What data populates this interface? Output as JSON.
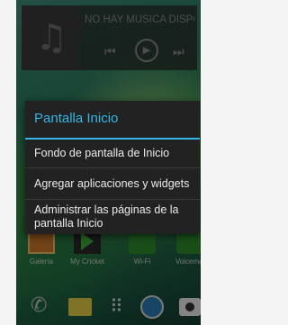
{
  "music_widget": {
    "title": "NO HAY MÚSICA DISPONIBLE",
    "album_icon": "music-note-icon",
    "prev_icon": "⏮",
    "play_icon": "▶",
    "next_icon": "⏭"
  },
  "dialog": {
    "title": "Pantalla Inicio",
    "options": [
      "Fondo de pantalla de Inicio",
      "Agregar aplicaciones y widgets",
      "Administrar las páginas de la pantalla Inicio"
    ],
    "accent_color": "#35b5e5"
  },
  "apps": [
    {
      "label": "Galería",
      "icon": "gallery-icon"
    },
    {
      "label": "My Cricket",
      "icon": "cricket-icon"
    },
    {
      "label": "Wi-Fi",
      "icon": "wifi-icon"
    },
    {
      "label": "Voicemail",
      "icon": "voicemail-icon"
    }
  ],
  "dock": {
    "phone": "✆",
    "apps": "⠿"
  }
}
